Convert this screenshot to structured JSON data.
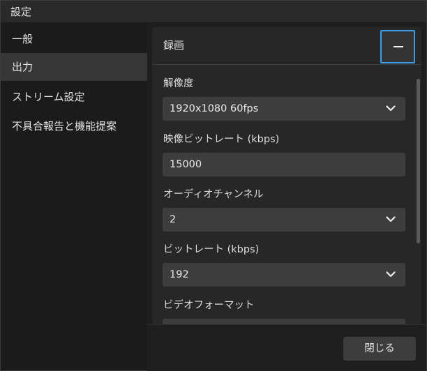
{
  "window": {
    "title": "設定"
  },
  "sidebar": {
    "items": [
      {
        "label": "一般",
        "active": false
      },
      {
        "label": "出力",
        "active": true
      },
      {
        "label": "ストリーム設定",
        "active": false
      },
      {
        "label": "不具合報告と機能提案",
        "active": false
      }
    ]
  },
  "section": {
    "title": "録画",
    "collapse_icon": "minus-icon"
  },
  "fields": {
    "resolution": {
      "label": "解像度",
      "value": "1920x1080 60fps"
    },
    "video_bitrate": {
      "label": "映像ビットレート (kbps)",
      "value": "15000"
    },
    "audio_channels": {
      "label": "オーディオチャンネル",
      "value": "2"
    },
    "bitrate": {
      "label": "ビットレート (kbps)",
      "value": "192"
    },
    "video_format": {
      "label": "ビデオフォーマット",
      "value": ""
    }
  },
  "footer": {
    "close_label": "閉じる"
  },
  "colors": {
    "accent": "#3a9de8",
    "panel": "#272727",
    "control": "#3d3d3d",
    "active_nav": "#373737"
  }
}
